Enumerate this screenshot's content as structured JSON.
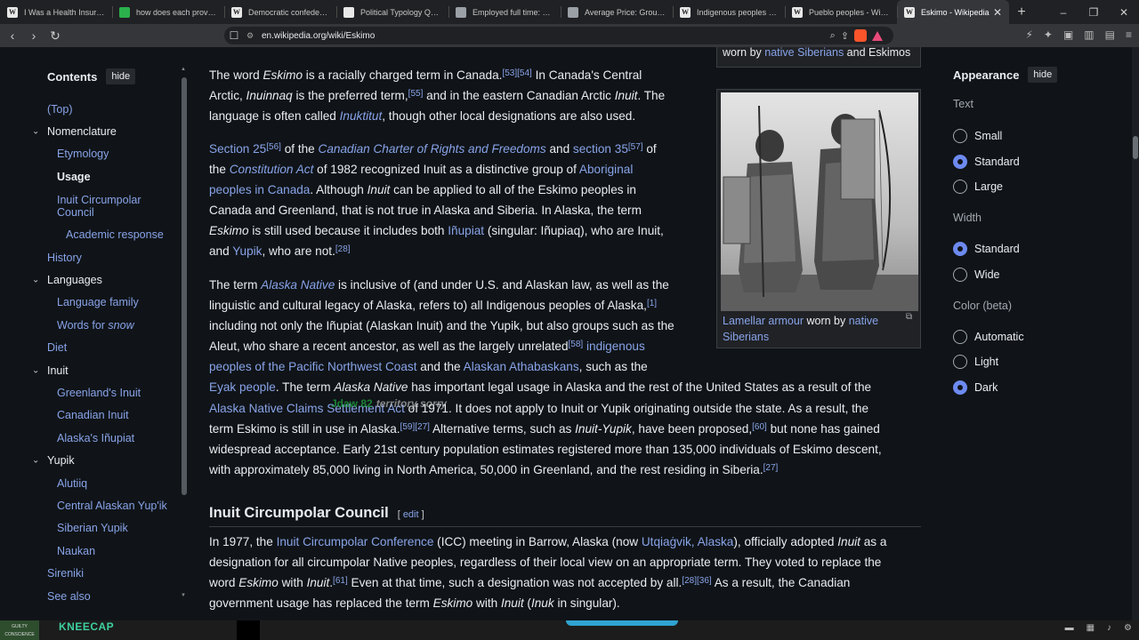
{
  "browser": {
    "tabs": [
      {
        "label": "I Was a Health Insurance E",
        "favicon": "w",
        "active": false
      },
      {
        "label": "how does each province h",
        "favicon": "g",
        "active": false
      },
      {
        "label": "Democratic confederalism",
        "favicon": "w",
        "active": false
      },
      {
        "label": "Political Typology Quiz | P",
        "favicon": "c",
        "active": false
      },
      {
        "label": "Employed full time: Media",
        "favicon": "img",
        "active": false
      },
      {
        "label": "Average Price: Ground Be",
        "favicon": "img",
        "active": false
      },
      {
        "label": "Indigenous peoples of the",
        "favicon": "w",
        "active": false
      },
      {
        "label": "Pueblo peoples - Wikiped",
        "favicon": "w",
        "active": false
      },
      {
        "label": "Eskimo - Wikipedia",
        "favicon": "w",
        "active": true
      }
    ],
    "url": "en.wikipedia.org/wiki/Eskimo"
  },
  "toc": {
    "title": "Contents",
    "hide": "hide",
    "items": [
      {
        "label": "(Top)",
        "level": 1,
        "expandable": false
      },
      {
        "label": "Nomenclature",
        "level": 1,
        "expandable": true
      },
      {
        "label": "Etymology",
        "level": 2
      },
      {
        "label": "Usage",
        "level": 2,
        "current": true
      },
      {
        "label": "Inuit Circumpolar Council",
        "level": 2,
        "twoLine": true
      },
      {
        "label": "Academic response",
        "level": 3
      },
      {
        "label": "History",
        "level": 1,
        "expandable": false
      },
      {
        "label": "Languages",
        "level": 1,
        "expandable": true
      },
      {
        "label": "Language family",
        "level": 2
      },
      {
        "label": "Words for snow",
        "level": 2,
        "italicTail": "snow"
      },
      {
        "label": "Diet",
        "level": 1,
        "expandable": false
      },
      {
        "label": "Inuit",
        "level": 1,
        "expandable": true
      },
      {
        "label": "Greenland's Inuit",
        "level": 2
      },
      {
        "label": "Canadian Inuit",
        "level": 2
      },
      {
        "label": "Alaska's Iñupiat",
        "level": 2
      },
      {
        "label": "Yupik",
        "level": 1,
        "expandable": true
      },
      {
        "label": "Alutiiq",
        "level": 2
      },
      {
        "label": "Central Alaskan Yup'ik",
        "level": 2
      },
      {
        "label": "Siberian Yupik",
        "level": 2
      },
      {
        "label": "Naukan",
        "level": 2
      },
      {
        "label": "Sireniki",
        "level": 1,
        "expandable": false
      },
      {
        "label": "See also",
        "level": 1,
        "expandable": false
      }
    ]
  },
  "article": {
    "section_heading": "Inuit Circumpolar Council",
    "edit": "edit"
  },
  "figure": {
    "top_caption_prefix": "worn by ",
    "top_caption_link": "native Siberians",
    "top_caption_suffix": " and Eskimos",
    "caption_link1": "Lamellar armour",
    "caption_mid": " worn by ",
    "caption_link2": "native Siberians"
  },
  "appearance": {
    "title": "Appearance",
    "hide": "hide",
    "text_group": "Text",
    "text_options": [
      {
        "label": "Small",
        "selected": false
      },
      {
        "label": "Standard",
        "selected": true
      },
      {
        "label": "Large",
        "selected": false
      }
    ],
    "width_group": "Width",
    "width_options": [
      {
        "label": "Standard",
        "selected": true
      },
      {
        "label": "Wide",
        "selected": false
      }
    ],
    "color_group": "Color (beta)",
    "color_options": [
      {
        "label": "Automatic",
        "selected": false
      },
      {
        "label": "Light",
        "selected": false
      },
      {
        "label": "Dark",
        "selected": true
      }
    ]
  },
  "overlay": {
    "text": "Jdaw 82",
    "text2": "territory sorry"
  },
  "taskbar": {
    "start_label": "GUILTY CONSCIENCE",
    "app_label": "KNEECAP"
  },
  "colors": {
    "link": "#88a3e8",
    "background": "#101418",
    "radio_on": "#6d8af0"
  }
}
